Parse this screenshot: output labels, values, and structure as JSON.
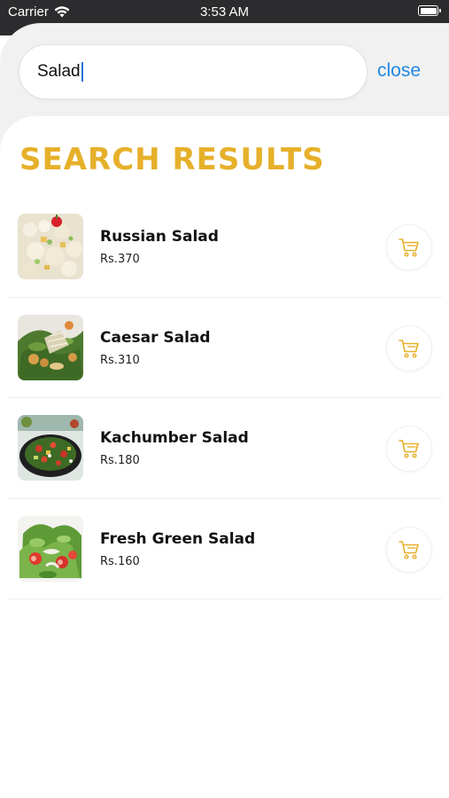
{
  "status_bar": {
    "carrier": "Carrier",
    "time": "3:53 AM"
  },
  "search": {
    "value": "Salad",
    "close_label": "close"
  },
  "results": {
    "title": "SEARCH RESULTS",
    "items": [
      {
        "name": "Russian Salad",
        "price": "Rs.370",
        "image": "russian-salad-photo"
      },
      {
        "name": "Caesar Salad",
        "price": "Rs.310",
        "image": "caesar-salad-photo"
      },
      {
        "name": "Kachumber Salad",
        "price": "Rs.180",
        "image": "kachumber-salad-photo"
      },
      {
        "name": "Fresh Green Salad",
        "price": "Rs.160",
        "image": "fresh-green-salad-photo"
      }
    ]
  },
  "colors": {
    "accent": "#e6b02a",
    "link": "#1e88e5",
    "header_bg": "#f1f1f1"
  },
  "icons": {
    "cart": "cart-icon",
    "wifi": "wifi-icon",
    "battery": "battery-icon"
  }
}
